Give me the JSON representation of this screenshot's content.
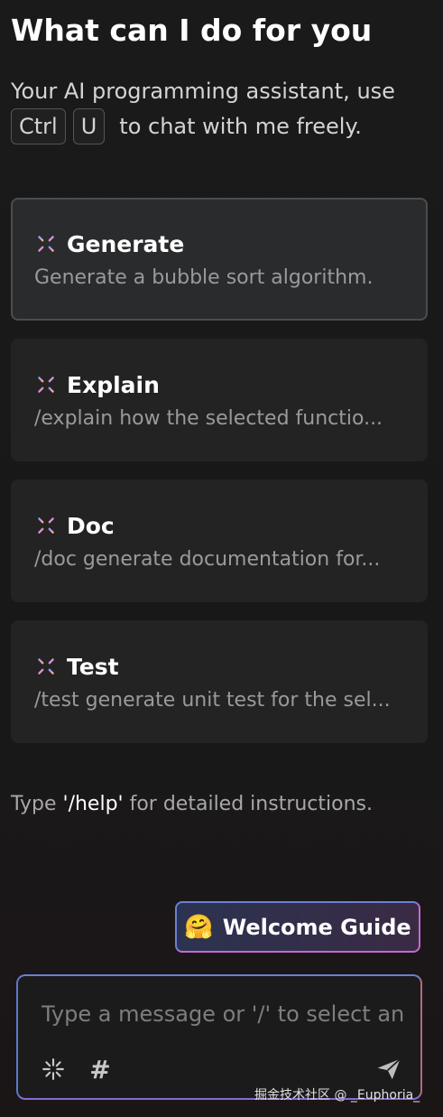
{
  "header": {
    "title": "What can I do for you",
    "subtitle_line1": "Your AI programming assistant, use",
    "key1": "Ctrl",
    "key2": "U",
    "subtitle_line2_text": "to chat with me freely."
  },
  "cards": [
    {
      "title": "Generate",
      "description": "Generate a bubble sort algorithm.",
      "icon": "sparkle-icon"
    },
    {
      "title": "Explain",
      "description": "/explain how the selected functio...",
      "icon": "sparkle-icon"
    },
    {
      "title": "Doc",
      "description": "/doc generate documentation for...",
      "icon": "sparkle-icon"
    },
    {
      "title": "Test",
      "description": "/test generate unit test for the sel...",
      "icon": "sparkle-icon"
    }
  ],
  "help": {
    "prefix": "Type ",
    "command": "'/help'",
    "suffix": " for detailed instructions."
  },
  "welcome": {
    "emoji": "🤗",
    "label": "Welcome Guide"
  },
  "composer": {
    "placeholder": "Type a message or '/' to select an agent",
    "hash": "#"
  },
  "watermark": "掘金技术社区 @ _Euphoria_",
  "colors": {
    "background": "#181818",
    "card": "#232323",
    "card_active": "#2a2b2d",
    "gradient_blue": "#6a7fd8",
    "gradient_pink": "#c26bd0"
  }
}
